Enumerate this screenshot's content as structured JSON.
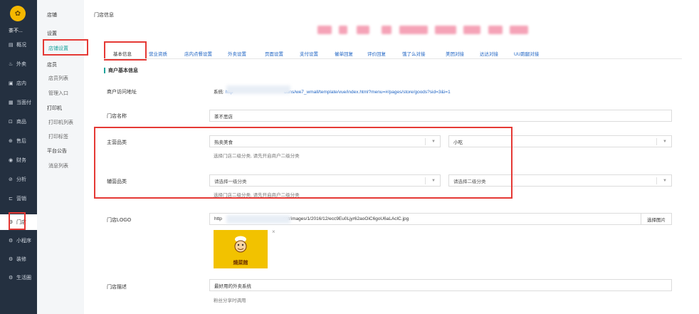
{
  "sidebar": {
    "logo_char": "✿",
    "shop_name": "茶不...",
    "items": [
      {
        "icon": "▤",
        "label": "概况"
      },
      {
        "icon": "♨",
        "label": "外卖"
      },
      {
        "icon": "▣",
        "label": "店内"
      },
      {
        "icon": "▦",
        "label": "当面付"
      },
      {
        "icon": "⊡",
        "label": "商品"
      },
      {
        "icon": "⊕",
        "label": "售后"
      },
      {
        "icon": "◉",
        "label": "财务"
      },
      {
        "icon": "⊘",
        "label": "分析"
      },
      {
        "icon": "⊏",
        "label": "营销"
      },
      {
        "icon": "⚙",
        "label": "门店"
      },
      {
        "icon": "⚙",
        "label": "小程序"
      },
      {
        "icon": "⚙",
        "label": "装修"
      },
      {
        "icon": "⚙",
        "label": "生活圈"
      }
    ]
  },
  "subnav": {
    "header": "店铺",
    "groups": [
      {
        "title": "设置"
      },
      {
        "item": "店铺设置"
      },
      {
        "title": "店员"
      },
      {
        "item": "店员列表"
      },
      {
        "item": "管理入口"
      },
      {
        "title": "打印机"
      },
      {
        "item": "打印机列表"
      },
      {
        "item": "打印标签"
      },
      {
        "title": "平台公告"
      },
      {
        "item": "消息列表"
      }
    ]
  },
  "header": {
    "breadcrumb": "门店信息"
  },
  "tabs": [
    "基本信息",
    "营业资质",
    "店内点餐设置",
    "外卖设置",
    "页面设置",
    "支付设置",
    "催单回复",
    "评价回复",
    "饿了么对接",
    "美团对接",
    "达达对接",
    "UU跑腿对接"
  ],
  "form": {
    "section_title": "商户基本信息",
    "visit_url_label": "商户访问地址",
    "visit_url_prefix": "系统:",
    "visit_url_head": "http",
    "visit_url_tail": "dons/we7_wmall/template/vue/index.html?menu=#/pages/store/goods?sid=3&i=1",
    "store_name_label": "门店名称",
    "store_name_value": "茶不思店",
    "main_category_label": "主营品类",
    "main_category_1": "热卖美食",
    "main_category_2": "小吃",
    "main_category_hint": "选择门店二级分类, 请先开启商户二级分类",
    "aux_category_label": "辅营品类",
    "aux_category_1": "请选择一级分类",
    "aux_category_2": "请选择二级分类",
    "aux_category_hint": "选择门店二级分类, 请先开启商户二级分类",
    "logo_label": "门店LOGO",
    "logo_url_head": "http",
    "logo_url_tail": "ent/images/1/2016/12/ecc9Eu0Ljyr62aoOiC6goU6aLAclC.jpg",
    "logo_pick_button": "选择图片",
    "logo_caption": "燒菜館",
    "desc_label": "门店描述",
    "desc_value": "最好用的外卖系统",
    "desc_hint": "粉丝分享时调用"
  },
  "accent_color": "#1aa39b",
  "highlight_color": "#e53935"
}
